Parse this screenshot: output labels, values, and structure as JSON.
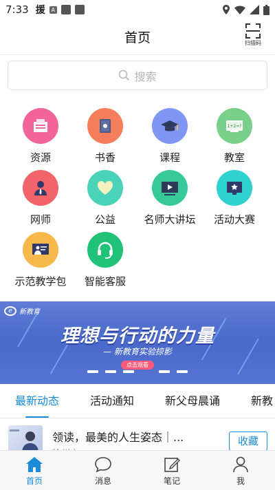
{
  "status_bar": {
    "time": "7:33",
    "left_icons": [
      "notification-yuan",
      "notification-a",
      "square-app",
      "square-app"
    ],
    "right_icons": [
      "location-icon",
      "wifi-icon",
      "signal-icon",
      "battery-icon"
    ]
  },
  "header": {
    "title": "首页",
    "scan_label": "扫描码"
  },
  "search": {
    "placeholder": "搜索"
  },
  "categories": [
    {
      "label": "资源",
      "color": "#f3649b",
      "icon": "resource-icon"
    },
    {
      "label": "书香",
      "color": "#f77e5c",
      "icon": "book-icon"
    },
    {
      "label": "课程",
      "color": "#7f96f5",
      "icon": "graduation-cap-icon"
    },
    {
      "label": "教室",
      "color": "#79d08b",
      "icon": "blackboard-icon"
    },
    {
      "label": "网师",
      "color": "#f2636b",
      "icon": "teacher-icon"
    },
    {
      "label": "公益",
      "color": "#4ad3b8",
      "icon": "heart-icon"
    },
    {
      "label": "名师大讲坛",
      "color": "#38c99a",
      "icon": "video-lecture-icon"
    },
    {
      "label": "活动大赛",
      "color": "#2fd2d0",
      "icon": "trophy-icon"
    },
    {
      "label": "示范教学包",
      "color": "#f7b94c",
      "icon": "teaching-package-icon"
    },
    {
      "label": "智能客服",
      "color": "#1fc277",
      "icon": "headset-icon"
    }
  ],
  "banner": {
    "logo_text": "新教育",
    "headline": "理想与行动的力量",
    "subtitle": "— 新教育实验掠影",
    "cta": "点击观看",
    "slide_count": 6,
    "active_slide": 3
  },
  "tabs": [
    {
      "label": "最新动态",
      "active": true
    },
    {
      "label": "活动通知",
      "active": false
    },
    {
      "label": "新父母晨诵",
      "active": false
    },
    {
      "label": "新教",
      "active": false
    }
  ],
  "list_item": {
    "title": "领读，最美的人生姿态｜...",
    "subtitle": "徐州市",
    "button": "收藏"
  },
  "bottom_nav": [
    {
      "label": "首页",
      "icon": "home-icon",
      "active": true
    },
    {
      "label": "消息",
      "icon": "message-icon",
      "active": false
    },
    {
      "label": "笔记",
      "icon": "note-icon",
      "active": false
    },
    {
      "label": "我",
      "icon": "user-icon",
      "active": false
    }
  ],
  "colors": {
    "accent": "#1a8cd8",
    "banner": "#5274d3"
  }
}
